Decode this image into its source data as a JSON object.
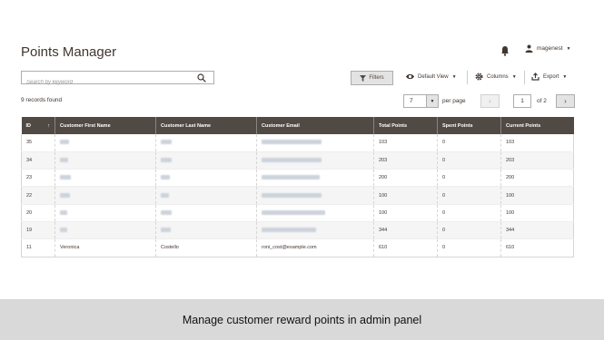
{
  "header": {
    "title": "Points Manager",
    "username": "magenest"
  },
  "toolbar": {
    "search_placeholder": "Search by keyword",
    "filters_label": "Filters",
    "default_view_label": "Default View",
    "columns_label": "Columns",
    "export_label": "Export"
  },
  "pagination": {
    "records_found": "9 records found",
    "per_page_value": "7",
    "per_page_label": "per page",
    "current_page": "1",
    "of_pages": "of 2",
    "prev_symbol": "‹",
    "next_symbol": "›"
  },
  "table": {
    "columns": [
      "ID",
      "Customer First Name",
      "Customer Last Name",
      "Customer Email",
      "Total Points",
      "Spent Points",
      "Current Points"
    ],
    "sort_indicator": "↑",
    "rows": [
      {
        "id": "35",
        "first": "",
        "last": "",
        "email": "",
        "total": "103",
        "spent": "0",
        "current": "103"
      },
      {
        "id": "34",
        "first": "",
        "last": "",
        "email": "",
        "total": "203",
        "spent": "0",
        "current": "203"
      },
      {
        "id": "23",
        "first": "",
        "last": "",
        "email": "",
        "total": "200",
        "spent": "0",
        "current": "200"
      },
      {
        "id": "22",
        "first": "",
        "last": "",
        "email": "",
        "total": "100",
        "spent": "0",
        "current": "100"
      },
      {
        "id": "20",
        "first": "",
        "last": "",
        "email": "",
        "total": "100",
        "spent": "0",
        "current": "100"
      },
      {
        "id": "19",
        "first": "",
        "last": "",
        "email": "",
        "total": "344",
        "spent": "0",
        "current": "344"
      },
      {
        "id": "11",
        "first": "Veronica",
        "last": "Costello",
        "email": "roni_cost@example.com",
        "total": "610",
        "spent": "0",
        "current": "610"
      }
    ]
  },
  "caption": "Manage customer reward points in admin panel",
  "icons": {
    "bell": "bell-icon",
    "user": "user-icon",
    "search": "search-icon",
    "filter": "funnel-icon",
    "eye": "eye-icon",
    "gear": "gear-icon",
    "export": "export-icon"
  },
  "colors": {
    "header_bg": "#514943",
    "caption_bg": "#d9d9d9",
    "button_bg": "#e3e3e3"
  }
}
